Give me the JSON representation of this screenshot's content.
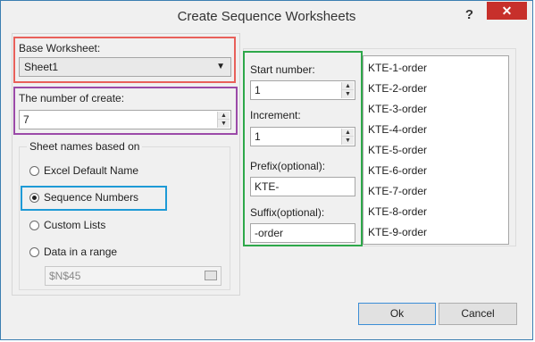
{
  "window": {
    "title": "Create Sequence Worksheets",
    "help": "?",
    "close": "✕"
  },
  "base_worksheet": {
    "label": "Base Worksheet:",
    "value": "Sheet1"
  },
  "number_of_create": {
    "label": "The number of create:",
    "value": "7"
  },
  "sheet_names": {
    "legend": "Sheet names based on",
    "options": [
      {
        "label": "Excel Default Name",
        "selected": false
      },
      {
        "label": "Sequence Numbers",
        "selected": true
      },
      {
        "label": "Custom Lists",
        "selected": false
      },
      {
        "label": "Data in a range",
        "selected": false
      }
    ],
    "range_value": "$N$45"
  },
  "sequence": {
    "start_label": "Start number:",
    "start_value": "1",
    "increment_label": "Increment:",
    "increment_value": "1",
    "prefix_label": "Prefix(optional):",
    "prefix_value": "KTE-",
    "suffix_label": "Suffix(optional):",
    "suffix_value": "-order"
  },
  "preview": [
    "KTE-1-order",
    "KTE-2-order",
    "KTE-3-order",
    "KTE-4-order",
    "KTE-5-order",
    "KTE-6-order",
    "KTE-7-order",
    "KTE-8-order",
    "KTE-9-order"
  ],
  "buttons": {
    "ok": "Ok",
    "cancel": "Cancel"
  },
  "highlight_colors": {
    "base": "#e8605a",
    "count": "#9b4aa8",
    "sequence_numbers": "#1e9ad6",
    "sequence": "#2ea84a"
  }
}
